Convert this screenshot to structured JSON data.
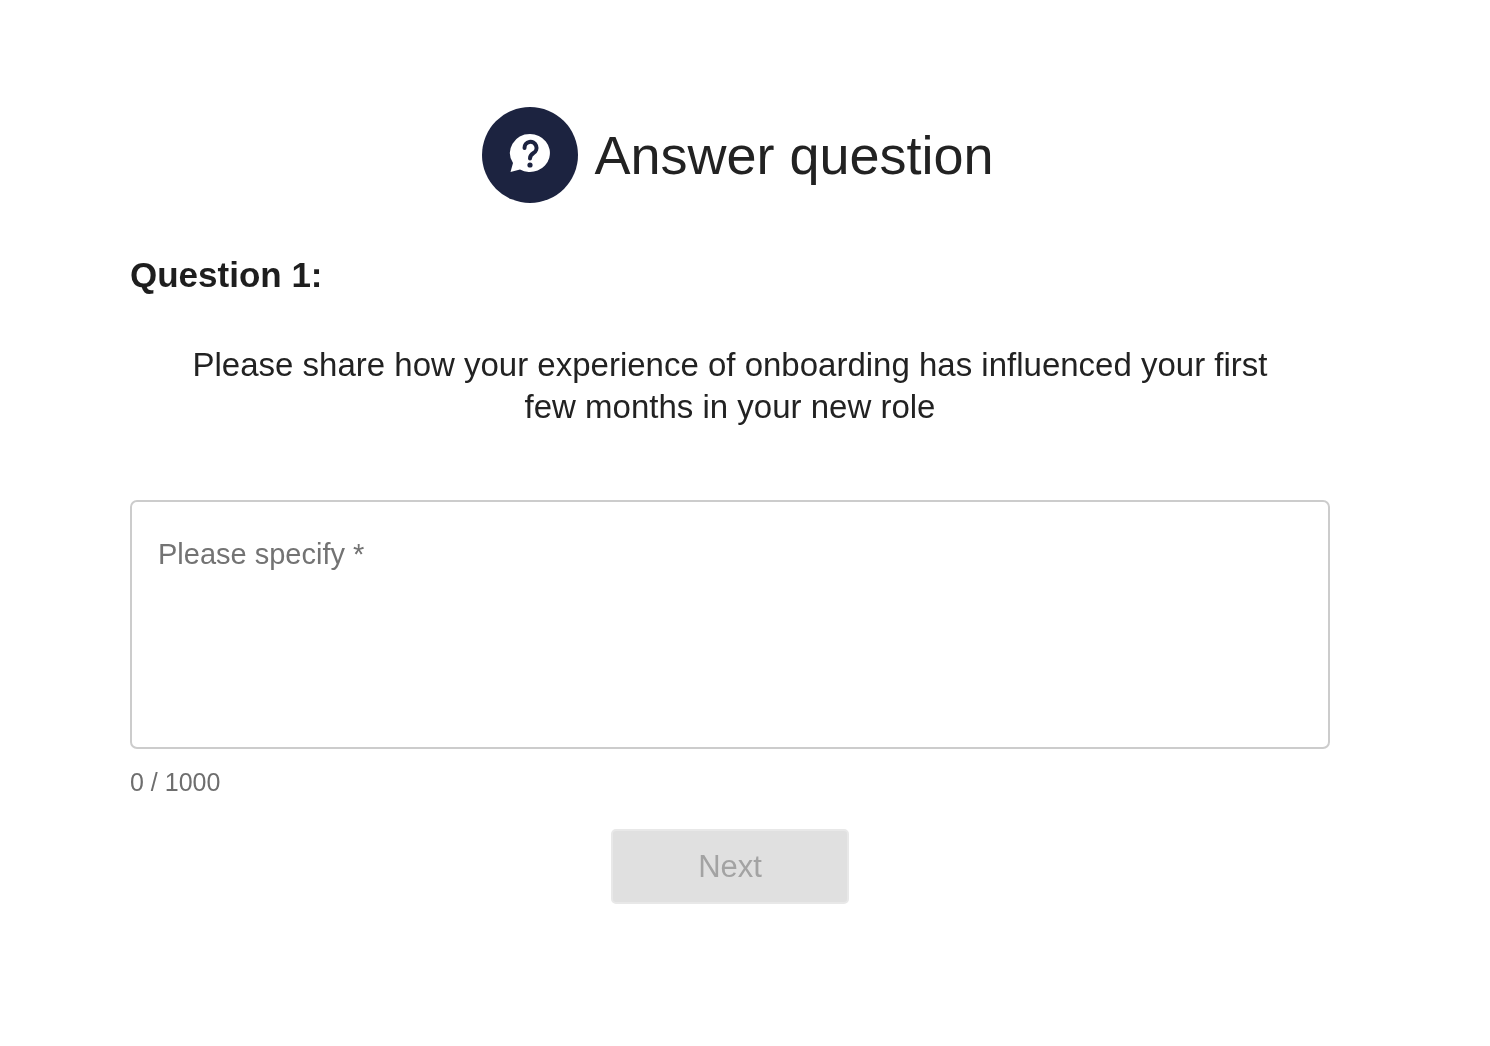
{
  "header": {
    "title": "Answer question"
  },
  "question": {
    "label": "Question 1:",
    "prompt": "Please share how your experience of onboarding has influenced your first few months in your new role"
  },
  "answer": {
    "placeholder": "Please specify *",
    "counter": "0 / 1000"
  },
  "buttons": [
    {
      "label": "Next",
      "disabled": true
    }
  ]
}
